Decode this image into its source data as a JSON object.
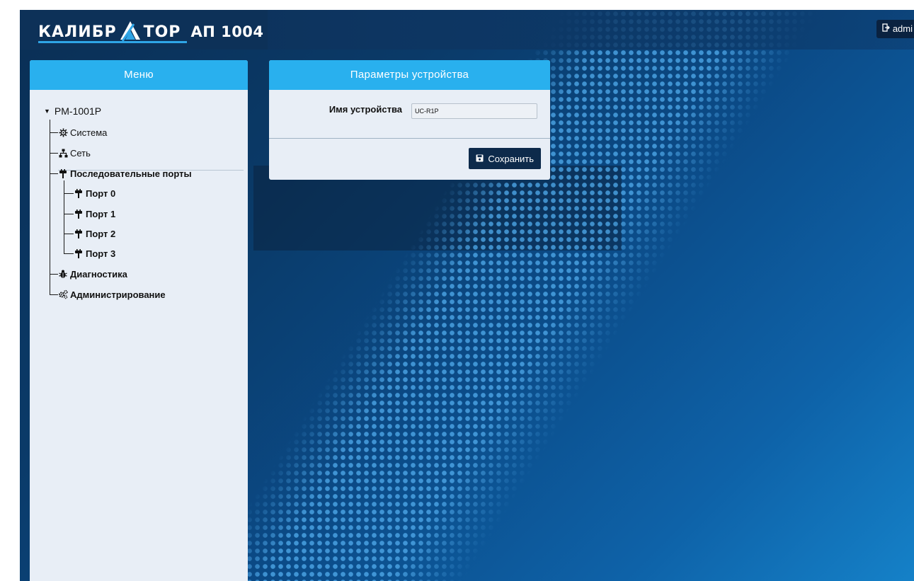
{
  "header": {
    "brand": "КАЛИБРАТОР",
    "brand_part1": "КАЛИБР",
    "brand_part2": "ТОР",
    "model": "АП 1004",
    "user_label": "admi"
  },
  "menu": {
    "title": "Меню",
    "root": "PM-1001P",
    "items": [
      {
        "label": "Система",
        "icon": "gear-icon"
      },
      {
        "label": "Сеть",
        "icon": "network-icon"
      },
      {
        "label": "Последовательные порты",
        "icon": "plug-icon"
      },
      {
        "label": "Порт 0",
        "icon": "plug-icon"
      },
      {
        "label": "Порт 1",
        "icon": "plug-icon"
      },
      {
        "label": "Порт 2",
        "icon": "plug-icon"
      },
      {
        "label": "Порт 3",
        "icon": "plug-icon"
      },
      {
        "label": "Диагностика",
        "icon": "bug-icon"
      },
      {
        "label": "Администрирование",
        "icon": "cogs-icon"
      }
    ]
  },
  "device_params": {
    "title": "Параметры устройства",
    "name_label": "Имя устройства",
    "name_value": "UC-R1P",
    "save_label": "Сохранить"
  },
  "colors": {
    "panel_header": "#29b0ee",
    "header_bg": "#0d3158",
    "save_button": "#0d2a4b"
  }
}
